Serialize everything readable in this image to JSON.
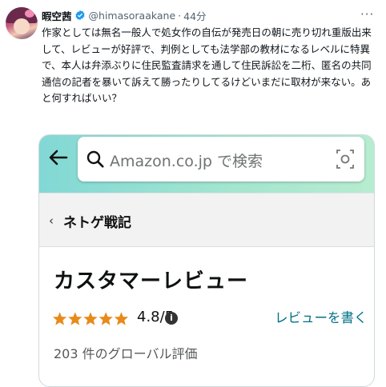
{
  "author": {
    "name": "暇空茜",
    "handle": "@himasoraakane",
    "time": "44分",
    "dot": "·",
    "verified": true,
    "avatar_icon": "avatar-image"
  },
  "more_label": "···",
  "tweet_text": "作家としては無名一般人で処女作の自伝が発売日の朝に売り切れ重版出来して、レビューが好評で、判例としても法学部の教材になるレベルに特異で、本人は弁添ぶりに住民監査請求を通して住民訴訟を二桁、匿名の共同通信の記者を暴いて訴えて勝ったりしてるけどいまだに取材が来ない。あと何すればいい？",
  "colors": {
    "verified": "#1d9bf0",
    "search_gradient": [
      "#82d8d5",
      "#b7ecd0"
    ],
    "star": "#e88a1a",
    "link": "#007185"
  },
  "amazon": {
    "back_icon": "back-arrow-icon",
    "search_placeholder": "Amazon.co.jp で検索",
    "breadcrumb_arrow": "‹",
    "breadcrumb": "ネトゲ戦記",
    "title": "カスタマーレビュー",
    "stars": 4.8,
    "rating_text": "4.8/5",
    "info_symbol": "i",
    "write_review": "レビューを書く",
    "global_ratings": "203 件のグローバル評価"
  }
}
